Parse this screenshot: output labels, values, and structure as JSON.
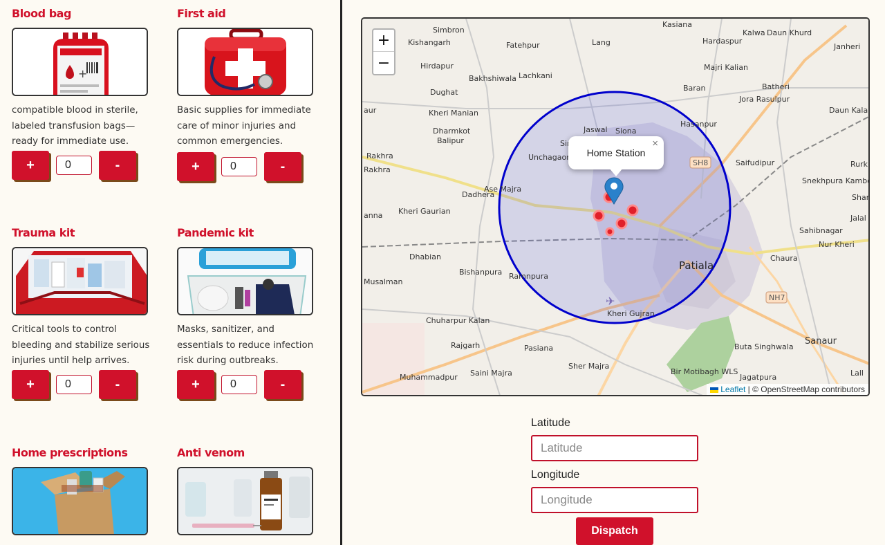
{
  "kits": [
    {
      "title": "Blood bag",
      "desc": "compatible blood in sterile, labeled transfusion bags—ready for immediate use.",
      "qty": "0"
    },
    {
      "title": "First aid",
      "desc": "Basic supplies for immediate care of minor injuries and common emergencies.",
      "qty": "0"
    },
    {
      "title": "Trauma kit",
      "desc": "Critical tools to control bleeding and stabilize serious injuries until help arrives.",
      "qty": "0"
    },
    {
      "title": "Pandemic kit",
      "desc": "Masks, sanitizer, and essentials to reduce infection risk during outbreaks.",
      "qty": "0"
    },
    {
      "title": "Home prescriptions",
      "desc": "",
      "qty": ""
    },
    {
      "title": "Anti venom",
      "desc": "",
      "qty": ""
    }
  ],
  "buttons": {
    "plus": "+",
    "minus": "-"
  },
  "map": {
    "zoom_in": "+",
    "zoom_out": "−",
    "popup_text": "Home Station",
    "popup_close": "×",
    "attribution_leaflet": "Leaflet",
    "attribution_rest": " | © OpenStreetMap contributors",
    "route_labels": [
      "SH8",
      "NH7"
    ],
    "places": [
      "Simbron",
      "Kishangarh",
      "Fatehpur",
      "Lang",
      "Kasiana",
      "Hardaspur",
      "Kalwa",
      "Daun Khurd",
      "Janheri",
      "Hirdapur",
      "Bakhshiwala",
      "Lachkani",
      "Majri Kalian",
      "Dughat",
      "Baran",
      "Batheri",
      "Jora Rasulpur",
      "Kheri Manian",
      "Daun Kala",
      "Dharmkot",
      "Balipur",
      "Jaswal",
      "Siona",
      "Hasanpur",
      "Unchagaon",
      "Rakhra",
      "Rakhra",
      "Saifudipur",
      "Dadhera",
      "Ase Majra",
      "Snekhpura Kambohan",
      "Kheri Gaurian",
      "Sahibnagar",
      "Nur Kheri",
      "Dhabian",
      "Patiala",
      "Chaura",
      "Bishanpura",
      "Ramnpura",
      "Musalman",
      "Kheri Gujran",
      "Chuharpur Kalan",
      "Rajgarh",
      "Pasiana",
      "Buta Singhwala",
      "Sanaur",
      "Sher Majra",
      "Muhammadpur",
      "Saini Majra",
      "Bir Motibagh WLS",
      "Jagatpura",
      "Sir",
      "aur",
      "anna",
      "Rurk",
      "Shar",
      "Jalal",
      "Lall"
    ]
  },
  "form": {
    "latitude_label": "Latitude",
    "latitude_placeholder": "Latitude",
    "longitude_label": "Longitude",
    "longitude_placeholder": "Longitude",
    "dispatch_label": "Dispatch"
  },
  "colors": {
    "accent": "#d0112b",
    "circle": "#0000cc",
    "circle_fill": "rgba(80,90,220,0.18)",
    "marker": "#2a81cb"
  }
}
